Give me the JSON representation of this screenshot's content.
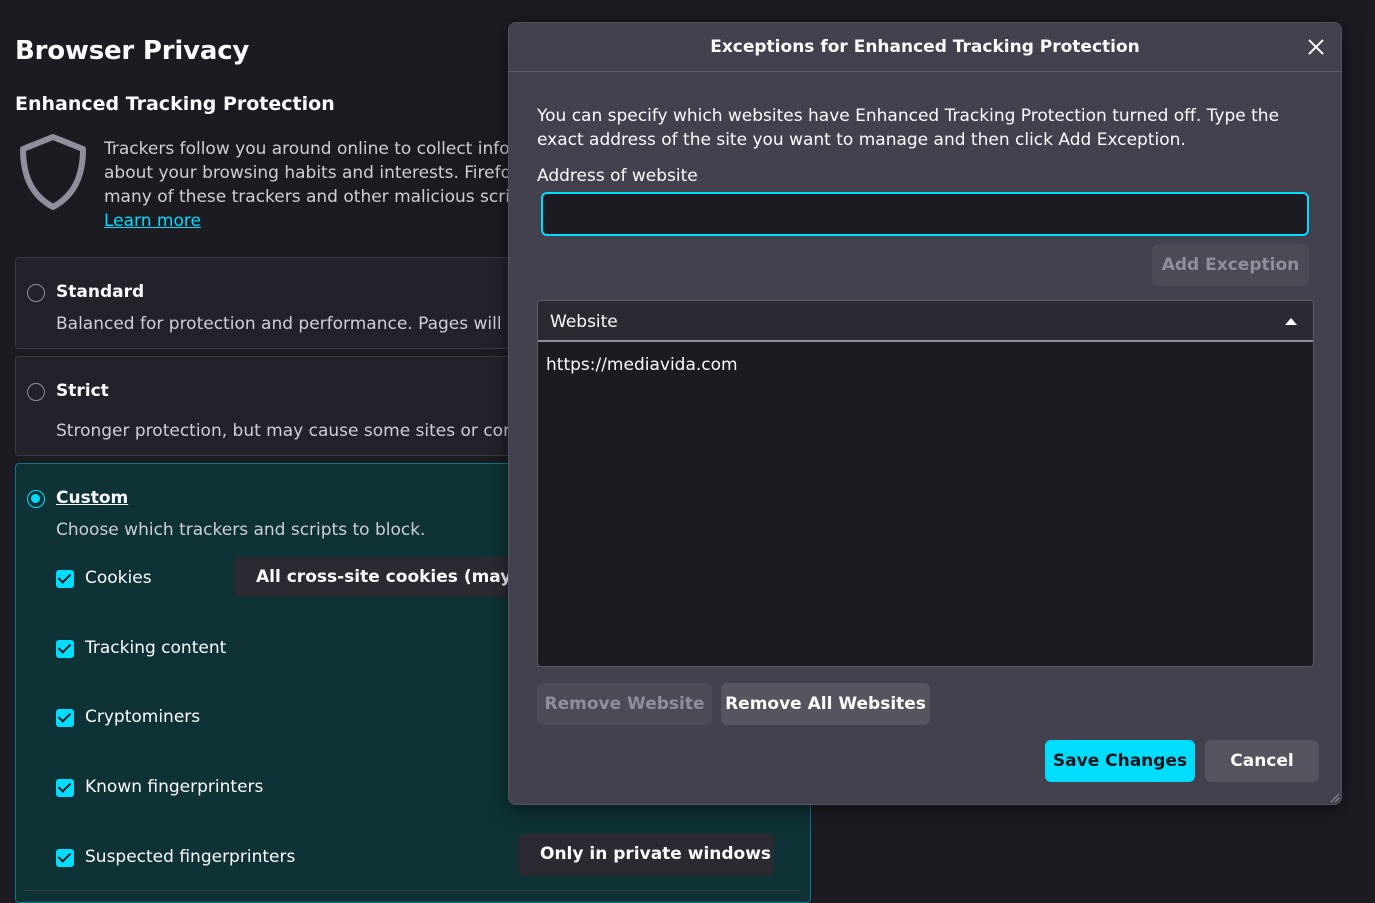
{
  "page": {
    "title": "Browser Privacy",
    "section_title": "Enhanced Tracking Protection",
    "intro_lines": [
      "Trackers follow you around online to collect information",
      "about your browsing habits and interests. Firefox blocks",
      "many of these trackers and other malicious scripts."
    ],
    "learn_more": "Learn more",
    "standard": {
      "label": "Standard",
      "description": "Balanced for protection and performance. Pages will load normally."
    },
    "strict": {
      "label": "Strict",
      "description": "Stronger protection, but may cause some sites or content to break."
    },
    "custom": {
      "label": "Custom",
      "description": "Choose which trackers and scripts to block.",
      "cookies_label": "Cookies",
      "cookies_select": "All cross-site cookies (may cause websites to break)",
      "tracking_content_label": "Tracking content",
      "cryptominers_label": "Cryptominers",
      "known_fp_label": "Known fingerprinters",
      "suspected_fp_label": "Suspected fingerprinters",
      "suspected_fp_select": "Only in private windows"
    }
  },
  "dialog": {
    "title": "Exceptions for Enhanced Tracking Protection",
    "description": "You can specify which websites have Enhanced Tracking Protection turned off. Type the exact address of the site you want to manage and then click Add Exception.",
    "address_label": "Address of website",
    "address_value": "",
    "add_exception": "Add Exception",
    "column_header": "Website",
    "websites": [
      "https://mediavida.com"
    ],
    "remove_website": "Remove Website",
    "remove_all": "Remove All Websites",
    "save": "Save Changes",
    "cancel": "Cancel"
  },
  "colors": {
    "accent": "#00ddff",
    "dialog_bg": "#42414d",
    "page_bg": "#1c1b22"
  }
}
